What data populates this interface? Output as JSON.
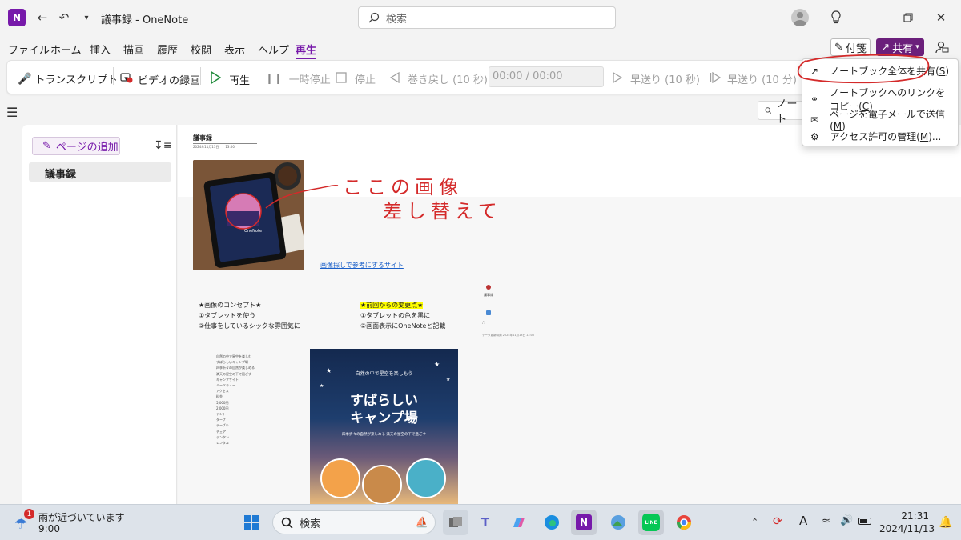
{
  "window": {
    "app_logo": "N",
    "title": "議事録 - OneNote",
    "search_placeholder": "検索"
  },
  "menu": {
    "items": [
      "ファイル",
      "ホーム",
      "挿入",
      "描画",
      "履歴",
      "校閲",
      "表示",
      "ヘルプ",
      "再生"
    ],
    "active": "再生",
    "sticky_label": "付箋",
    "share_label": "共有"
  },
  "ribbon": {
    "transcript": "トランスクリプト",
    "record_video": "ビデオの録画",
    "play": "再生",
    "pause": "一時停止",
    "stop": "停止",
    "rewind": "巻き戻し (10 秒)",
    "time": "00:00 / 00:00",
    "forward10": "早送り (10 秒)",
    "forward10m": "早送り (10 分)"
  },
  "search2_label": "ノート",
  "pages": {
    "add_page": "ページの追加",
    "items": [
      "議事録"
    ]
  },
  "note": {
    "title": "議事録",
    "date": "2024年11月13日　　13:00",
    "img_link": "画像探しで参考にするサイト",
    "handwriting_line1": "ここの画像",
    "handwriting_line2": "差し替えて",
    "concept_heading": "★画像のコンセプト★",
    "concept_lines": [
      "①タブレットを使う",
      "②仕事をしているシックな雰囲気に"
    ],
    "changes_heading": "★前回からの変更点★",
    "changes_lines": [
      "①タブレットの色を黒に",
      "②画面表示にOneNoteと記載"
    ],
    "side_small_1": "議事録",
    "side_small_2": "データ更新時刻 2024年11月13日 13:00",
    "tablet_label": "OneNote",
    "list_items": [
      "自然の中で星空を楽しむ",
      "すばらしいキャンプ場",
      "四季折々の自然が楽しめる",
      "満天の星空の下で過ごす",
      "キャンプサイト",
      "バーベキュー",
      "アクセス",
      "料金",
      "5,000円",
      "2,000円",
      "テント",
      "タープ",
      "テーブル",
      "チェア",
      "ランタン",
      "レンタル"
    ],
    "poster_top": "自然の中で星空を楽しもう",
    "poster_title_1": "すばらしい",
    "poster_title_2": "キャンプ場",
    "poster_sub": "四季折々の自然が楽しめる 満天の星空の下で過ごす"
  },
  "share_menu": {
    "items": [
      {
        "label": "ノートブック全体を共有(",
        "key": "S",
        "suffix": ")",
        "icon": "share-icon"
      },
      {
        "label": "ノートブックへのリンクをコピー(",
        "key": "C",
        "suffix": ")",
        "icon": "link-icon"
      },
      {
        "label": "ページを電子メールで送信(",
        "key": "M",
        "suffix": ")",
        "icon": "mail-icon"
      },
      {
        "label": "アクセス許可の管理(",
        "key": "M",
        "suffix": ")...",
        "icon": "settings-icon"
      }
    ]
  },
  "taskbar": {
    "weather_badge": "1",
    "weather_text": "雨が近づいています",
    "weather_time": "9:00",
    "search_placeholder": "検索",
    "time": "21:31",
    "date": "2024/11/13",
    "ime": "A",
    "line_label": "LINE"
  },
  "colors": {
    "accent": "#7719aa",
    "share_button": "#6b1f7b",
    "annotation_red": "#d42a2a"
  }
}
